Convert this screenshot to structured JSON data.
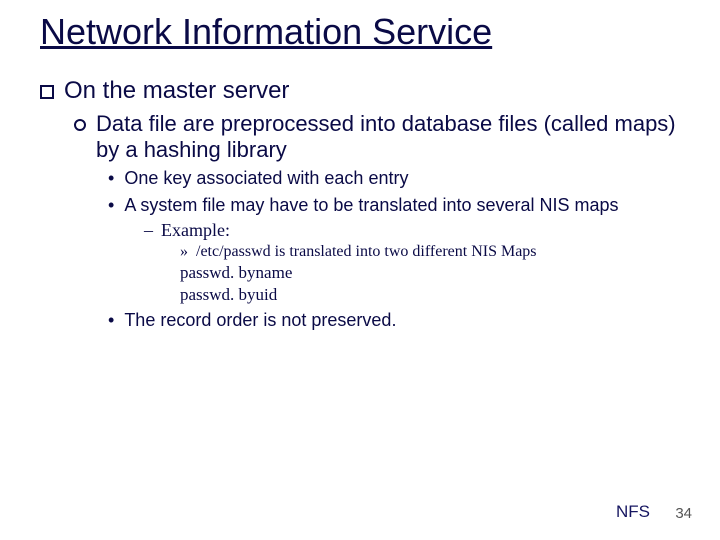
{
  "title": "Network Information Service",
  "bullets": {
    "lvl1_0": "On the master server",
    "lvl2_0": "Data file are preprocessed into database files (called maps) by a hashing library",
    "lvl3_0": "One key associated with each entry",
    "lvl3_1": "A system file may have to be translated into several NIS maps",
    "lvl4_0": "Example:",
    "lvl5_0": "/etc/passwd is translated into two different NIS Maps",
    "lvl5_1": "passwd. byname",
    "lvl5_2": "passwd. byuid",
    "lvl3_2": "The record order is not preserved."
  },
  "footer": {
    "label": "NFS",
    "page": "34"
  }
}
